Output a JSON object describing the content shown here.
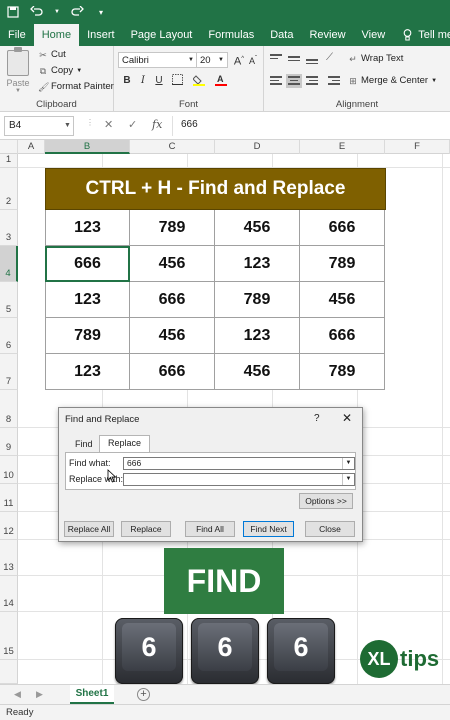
{
  "ribbon_tabs": [
    "File",
    "Home",
    "Insert",
    "Page Layout",
    "Formulas",
    "Data",
    "Review",
    "View"
  ],
  "tell_me": "Tell me w",
  "clipboard": {
    "paste": "Paste",
    "cut": "Cut",
    "copy": "Copy",
    "format_painter": "Format Painter",
    "label": "Clipboard"
  },
  "font": {
    "name": "Calibri",
    "size": "20",
    "label": "Font",
    "bold": "B",
    "italic": "I",
    "underline": "U"
  },
  "alignment": {
    "wrap_text": "Wrap Text",
    "merge_center": "Merge & Center",
    "label": "Alignment"
  },
  "formula_bar": {
    "name_box": "B4",
    "fx": "fx",
    "value": "666"
  },
  "columns": [
    "A",
    "B",
    "C",
    "D",
    "E",
    "F"
  ],
  "rows": [
    "1",
    "2",
    "3",
    "4",
    "5",
    "6",
    "7",
    "8",
    "9",
    "10",
    "11",
    "12",
    "13",
    "14",
    "15"
  ],
  "table": {
    "title": "CTRL + H - Find and Replace",
    "rows": [
      [
        "123",
        "789",
        "456",
        "666"
      ],
      [
        "666",
        "456",
        "123",
        "789"
      ],
      [
        "123",
        "666",
        "789",
        "456"
      ],
      [
        "789",
        "456",
        "123",
        "666"
      ],
      [
        "123",
        "666",
        "456",
        "789"
      ]
    ]
  },
  "dialog": {
    "title": "Find and Replace",
    "help": "?",
    "close_x": "✕",
    "tab_find": "Find",
    "tab_replace": "Replace",
    "find_label": "Find what:",
    "find_value": "666",
    "replace_label": "Replace with:",
    "replace_value": "",
    "options": "Options >>",
    "replace_all": "Replace All",
    "replace": "Replace",
    "find_all": "Find All",
    "find_next": "Find Next",
    "close": "Close"
  },
  "overlay": {
    "banner": "FIND",
    "keys": [
      "6",
      "6",
      "6"
    ],
    "logo_xl": "XL",
    "logo_tips": "tips"
  },
  "sheets": [
    "Sheet1"
  ],
  "status": "Ready",
  "colors": {
    "excel_green": "#217346",
    "title_fill": "#7f6000",
    "banner_green": "#2f7d41"
  }
}
